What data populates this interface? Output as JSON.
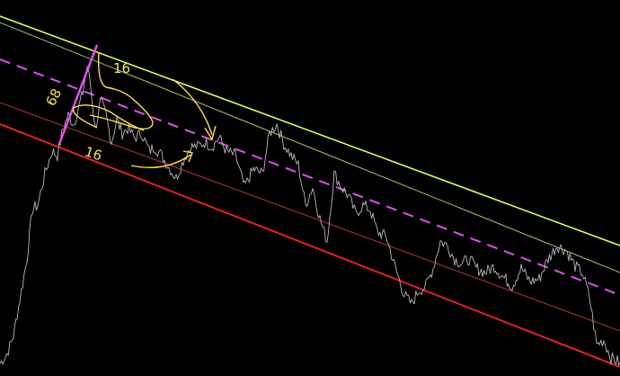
{
  "chart_data": {
    "type": "line",
    "title": "",
    "xlabel": "",
    "ylabel": "",
    "grid": false,
    "background": "#000000",
    "price_color": "#b8b8b8",
    "annotation_color": "#ffe34a",
    "price_series": {
      "x": [
        0,
        8,
        15,
        22,
        30,
        36,
        42,
        50,
        58,
        64,
        70,
        76,
        82,
        88,
        92,
        97,
        100,
        106,
        112,
        118,
        124,
        130,
        136,
        142,
        150,
        158,
        166,
        172,
        180,
        188,
        196,
        204,
        212,
        220,
        228,
        236,
        244,
        252,
        262,
        272,
        282,
        292,
        300,
        308,
        316,
        324,
        332,
        340,
        348,
        356,
        364,
        372,
        380,
        388,
        396,
        404,
        412,
        420,
        430,
        440,
        450,
        458,
        466,
        474,
        482,
        490,
        498,
        506,
        514,
        522,
        530,
        540,
        550,
        560,
        570,
        580,
        590,
        600,
        610,
        620,
        630,
        640,
        648,
        656,
        664,
        672,
        680,
        690
      ],
      "y": [
        14,
        25,
        45,
        85,
        130,
        185,
        190,
        225,
        250,
        245,
        275,
        290,
        280,
        300,
        315,
        345,
        330,
        275,
        305,
        290,
        260,
        285,
        270,
        275,
        265,
        270,
        250,
        255,
        245,
        232,
        220,
        240,
        255,
        255,
        260,
        255,
        265,
        250,
        245,
        210,
        230,
        225,
        270,
        280,
        258,
        245,
        235,
        190,
        210,
        175,
        150,
        225,
        210,
        200,
        180,
        190,
        185,
        160,
        155,
        120,
        90,
        80,
        95,
        100,
        120,
        150,
        145,
        130,
        125,
        130,
        120,
        115,
        122,
        110,
        100,
        120,
        105,
        108,
        130,
        145,
        140,
        122,
        115,
        88,
        35,
        40,
        20,
        15
      ]
    },
    "channel_lines": [
      {
        "name": "",
        "color": "#dcff5a",
        "style": "solid",
        "width": 1.6,
        "points": [
          [
            0,
            400
          ],
          [
            690,
            145
          ]
        ]
      },
      {
        "name": "",
        "color": "#b7dc73",
        "style": "solid",
        "width": 0.9,
        "points": [
          [
            0,
            393
          ],
          [
            690,
            115
          ]
        ]
      },
      {
        "name": "",
        "color": "#e24ff0",
        "style": "dashed",
        "width": 2,
        "points": [
          [
            0,
            352
          ],
          [
            690,
            90
          ]
        ]
      },
      {
        "name": "",
        "color": "#c43a3a",
        "style": "solid",
        "width": 0.9,
        "points": [
          [
            0,
            304
          ],
          [
            690,
            50
          ]
        ]
      },
      {
        "name": "",
        "color": "#ff2020",
        "style": "solid",
        "width": 1.8,
        "points": [
          [
            0,
            280
          ],
          [
            690,
            10
          ]
        ]
      }
    ],
    "annotations": [
      "68",
      "16",
      "16"
    ]
  }
}
